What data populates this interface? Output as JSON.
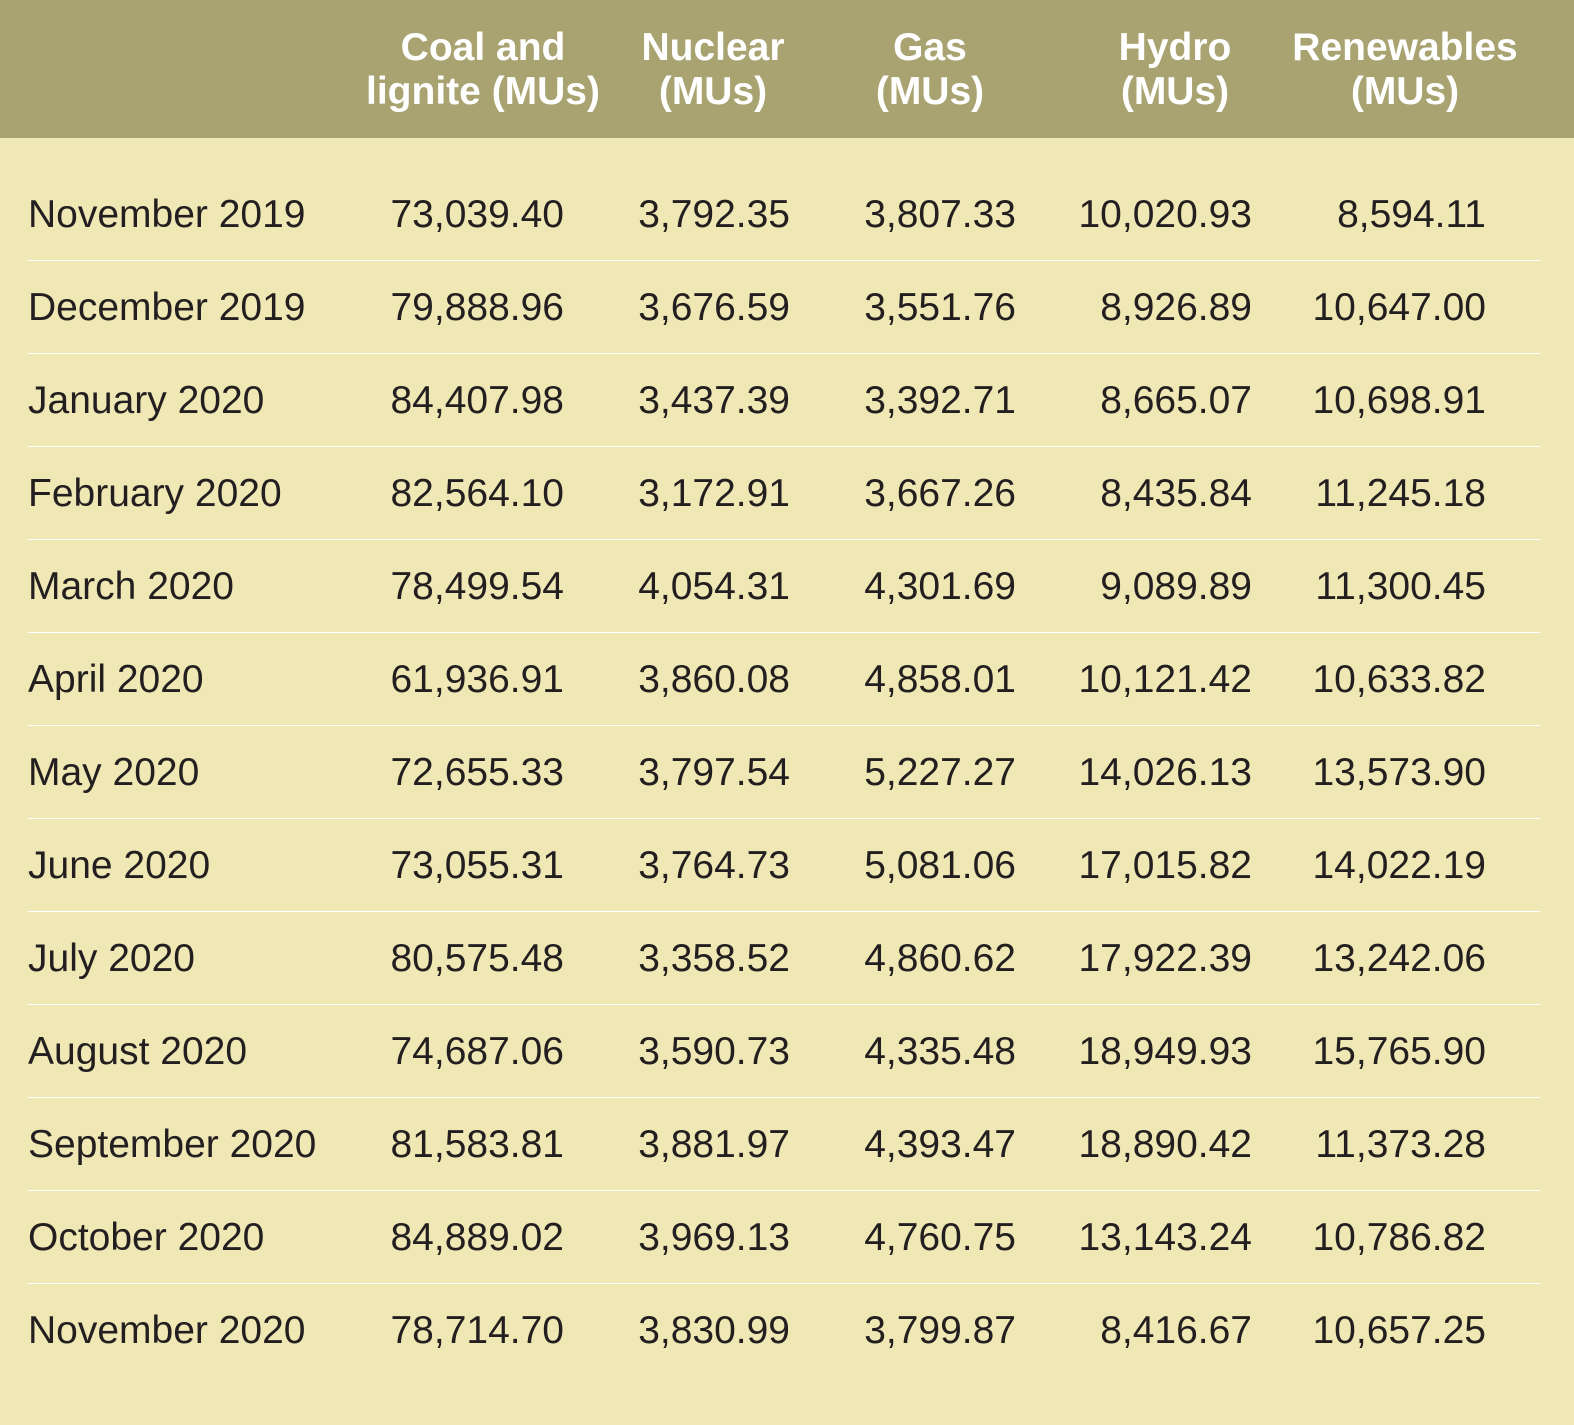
{
  "table": {
    "columns": [
      {
        "key": "month",
        "label": ""
      },
      {
        "key": "coal",
        "label": "Coal and\nlignite (MUs)"
      },
      {
        "key": "nuclear",
        "label": "Nuclear\n(MUs)"
      },
      {
        "key": "gas",
        "label": "Gas\n(MUs)"
      },
      {
        "key": "hydro",
        "label": "Hydro\n(MUs)"
      },
      {
        "key": "renewables",
        "label": "Renewables\n(MUs)"
      }
    ],
    "rows": [
      {
        "month": "November 2019",
        "coal": "73,039.40",
        "nuclear": "3,792.35",
        "gas": "3,807.33",
        "hydro": "10,020.93",
        "renewables": "8,594.11"
      },
      {
        "month": "December 2019",
        "coal": "79,888.96",
        "nuclear": "3,676.59",
        "gas": "3,551.76",
        "hydro": "8,926.89",
        "renewables": "10,647.00"
      },
      {
        "month": "January 2020",
        "coal": "84,407.98",
        "nuclear": "3,437.39",
        "gas": "3,392.71",
        "hydro": "8,665.07",
        "renewables": "10,698.91"
      },
      {
        "month": "February 2020",
        "coal": "82,564.10",
        "nuclear": "3,172.91",
        "gas": "3,667.26",
        "hydro": "8,435.84",
        "renewables": "11,245.18"
      },
      {
        "month": "March 2020",
        "coal": "78,499.54",
        "nuclear": "4,054.31",
        "gas": "4,301.69",
        "hydro": "9,089.89",
        "renewables": "11,300.45"
      },
      {
        "month": "April 2020",
        "coal": "61,936.91",
        "nuclear": "3,860.08",
        "gas": "4,858.01",
        "hydro": "10,121.42",
        "renewables": "10,633.82"
      },
      {
        "month": "May 2020",
        "coal": "72,655.33",
        "nuclear": "3,797.54",
        "gas": "5,227.27",
        "hydro": "14,026.13",
        "renewables": "13,573.90"
      },
      {
        "month": "June 2020",
        "coal": "73,055.31",
        "nuclear": "3,764.73",
        "gas": "5,081.06",
        "hydro": "17,015.82",
        "renewables": "14,022.19"
      },
      {
        "month": "July 2020",
        "coal": "80,575.48",
        "nuclear": "3,358.52",
        "gas": "4,860.62",
        "hydro": "17,922.39",
        "renewables": "13,242.06"
      },
      {
        "month": "August 2020",
        "coal": "74,687.06",
        "nuclear": "3,590.73",
        "gas": "4,335.48",
        "hydro": "18,949.93",
        "renewables": "15,765.90"
      },
      {
        "month": "September 2020",
        "coal": "81,583.81",
        "nuclear": "3,881.97",
        "gas": "4,393.47",
        "hydro": "18,890.42",
        "renewables": "11,373.28"
      },
      {
        "month": "October 2020",
        "coal": "84,889.02",
        "nuclear": "3,969.13",
        "gas": "4,760.75",
        "hydro": "13,143.24",
        "renewables": "10,786.82"
      },
      {
        "month": "November 2020",
        "coal": "78,714.70",
        "nuclear": "3,830.99",
        "gas": "3,799.87",
        "hydro": "8,416.67",
        "renewables": "10,657.25"
      }
    ]
  },
  "colors": {
    "header_background": "#a8a370",
    "body_background": "#f0e8b4",
    "header_text": "#ffffff",
    "body_text": "#231f20",
    "row_separator": "#ffffff"
  }
}
